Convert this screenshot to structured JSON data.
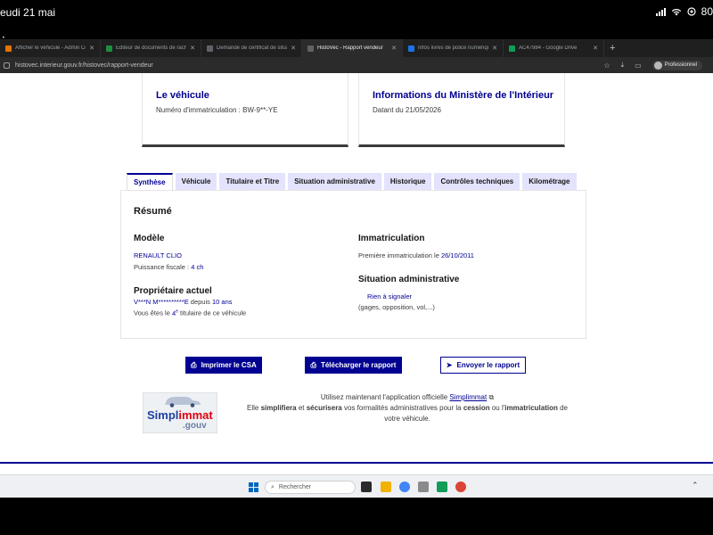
{
  "status_bar": {
    "date": "eudi 21 mai",
    "battery": "80"
  },
  "screenshot_label": "image.png",
  "browser": {
    "tabs": [
      {
        "label": "Afficher le véhicule - Admin Co",
        "color": "#e37400",
        "active": false
      },
      {
        "label": "Éditeur de documents de rachat",
        "color": "#1e8e3e",
        "active": false
      },
      {
        "label": "Demande de certificat de situati",
        "color": "#5f6368",
        "active": false
      },
      {
        "label": "HistoVec - Rapport vendeur",
        "color": "#5f6368",
        "active": true
      },
      {
        "label": "Infos livres de police numériqu",
        "color": "#1a73e8",
        "active": false
      },
      {
        "label": "AC47984 - Google Drive",
        "color": "#0f9d58",
        "active": false
      }
    ],
    "new_tab": "+",
    "url": "histovec.interieur.gouv.fr/histovec/rapport-vendeur",
    "profile": "Professionnel"
  },
  "cards": {
    "vehicle": {
      "title": "Le véhicule",
      "subtitle": "Numéro d'immatriculation : BW-9**-YE"
    },
    "ministry": {
      "title": "Informations du Ministère de l'Intérieur",
      "subtitle": "Datant du 21/05/2026"
    }
  },
  "report_tabs": [
    "Synthèse",
    "Véhicule",
    "Titulaire et Titre",
    "Situation administrative",
    "Historique",
    "Contrôles techniques",
    "Kilométrage"
  ],
  "summary": {
    "heading": "Résumé",
    "model": {
      "heading": "Modèle",
      "name": "RENAULT CLIO",
      "power_label": "Puissance fiscale :",
      "power_value": "4 ch"
    },
    "owner": {
      "heading": "Propriétaire actuel",
      "name": "V***N M**********E",
      "since_label": "depuis",
      "since_value": "10 ans",
      "rank_prefix": "Vous êtes le",
      "rank_num": "4",
      "rank_sup": "e",
      "rank_suffix": "titulaire de ce véhicule"
    },
    "registration": {
      "heading": "Immatriculation",
      "first_label": "Première immatriculation le",
      "first_date": "26/10/2011"
    },
    "admin": {
      "heading": "Situation administrative",
      "status": "Rien à signaler",
      "details": "(gages, opposition, vol,...)"
    }
  },
  "actions": {
    "print": "Imprimer le CSA",
    "download": "Télécharger le rapport",
    "send": "Envoyer le rapport"
  },
  "promo": {
    "logo_part1": "Simpl",
    "logo_part2": "immat",
    "logo_gouv": ".gouv",
    "line1_prefix": "Utilisez maintenant l'application officielle",
    "line1_link": "Simplimmat",
    "line2_a": "Elle",
    "line2_b": "simplifiera",
    "line2_c": "et",
    "line2_d": "sécurisera",
    "line2_e": "vos formalités administratives pour la",
    "line2_f": "cession",
    "line2_g": "ou l'",
    "line2_h": "immatriculation",
    "line2_i": "de",
    "line3": "votre véhicule."
  },
  "taskbar": {
    "search_placeholder": "Rechercher"
  }
}
